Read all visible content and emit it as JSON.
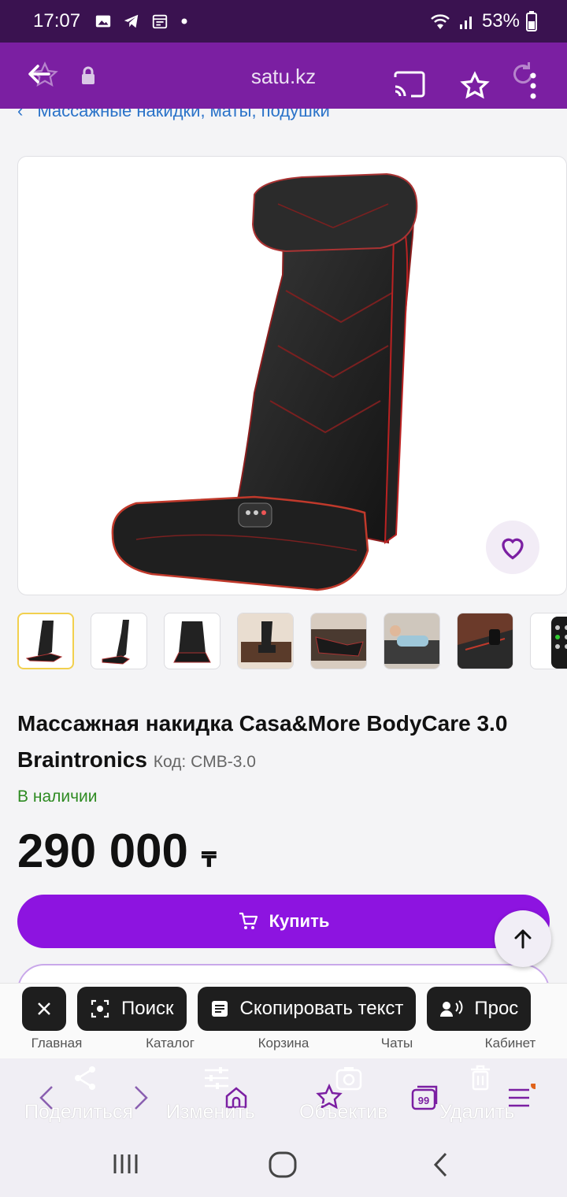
{
  "status_bar": {
    "time": "17:07",
    "battery": "53%"
  },
  "browser": {
    "url": "satu.kz"
  },
  "breadcrumb": {
    "label": "Массажные накидки, маты, подушки"
  },
  "product": {
    "title": "Массажная накидка Casa&More BodyCare 3.0 Braintronics",
    "code_label": "Код: CMB-3.0",
    "availability": "В наличии",
    "price": "290 000",
    "currency": "₸",
    "buy_label": "Купить",
    "thumbnail_count": 8,
    "selected_thumbnail": 1
  },
  "app_nav": {
    "items": [
      {
        "label": "Главная"
      },
      {
        "label": "Каталог"
      },
      {
        "label": "Корзина"
      },
      {
        "label": "Чаты"
      },
      {
        "label": "Кабинет"
      }
    ]
  },
  "selection_chips": {
    "search": "Поиск",
    "copy_text": "Скопировать текст",
    "listen": "Прос"
  },
  "action_bar": {
    "share": "Поделиться",
    "edit": "Изменить",
    "lens": "Объектив",
    "delete": "Удалить"
  },
  "colors": {
    "status_bar": "#3a1250",
    "toolbar": "#7b1fa2",
    "buy_button": "#8d14e0",
    "in_stock": "#2e8b22",
    "link": "#2b73c9"
  }
}
